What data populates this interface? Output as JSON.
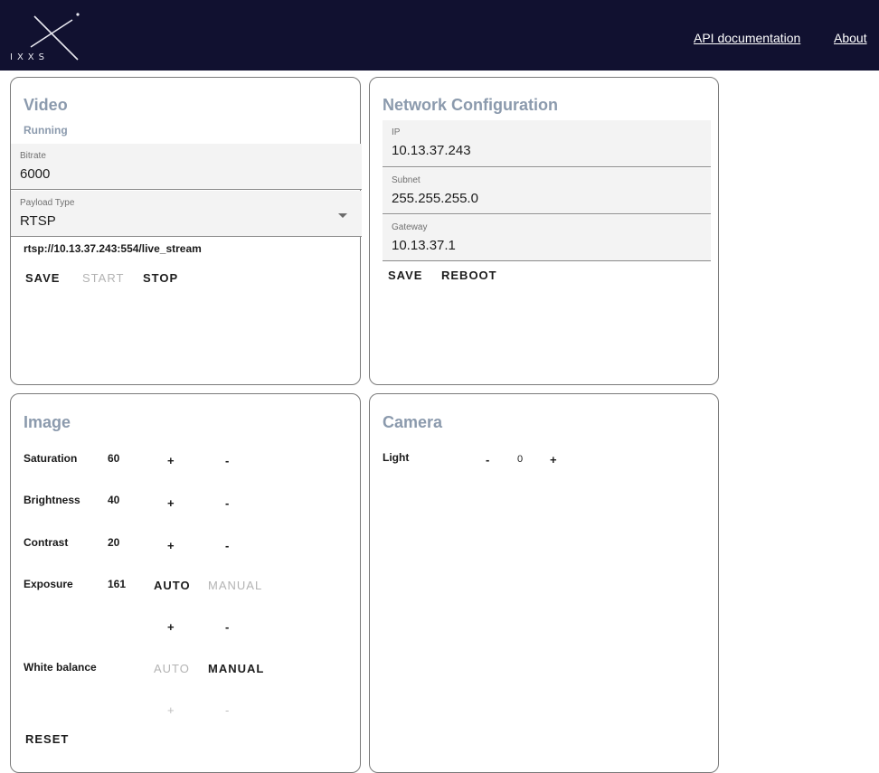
{
  "header": {
    "logo_text": "IXXS",
    "nav": {
      "api_documentation": "API documentation",
      "about": "About"
    }
  },
  "video": {
    "title": "Video",
    "status": "Running",
    "bitrate": {
      "label": "Bitrate",
      "value": "6000"
    },
    "payload_type": {
      "label": "Payload Type",
      "value": "RTSP"
    },
    "stream_url": "rtsp://10.13.37.243:554/live_stream",
    "buttons": {
      "save": "SAVE",
      "start": "START",
      "stop": "STOP"
    }
  },
  "network": {
    "title": "Network Configuration",
    "ip": {
      "label": "IP",
      "value": "10.13.37.243"
    },
    "subnet": {
      "label": "Subnet",
      "value": "255.255.255.0"
    },
    "gateway": {
      "label": "Gateway",
      "value": "10.13.37.1"
    },
    "buttons": {
      "save": "SAVE",
      "reboot": "REBOOT"
    }
  },
  "image": {
    "title": "Image",
    "saturation": {
      "label": "Saturation",
      "value": "60",
      "plus": "+",
      "minus": "-"
    },
    "brightness": {
      "label": "Brightness",
      "value": "40",
      "plus": "+",
      "minus": "-"
    },
    "contrast": {
      "label": "Contrast",
      "value": "20",
      "plus": "+",
      "minus": "-"
    },
    "exposure": {
      "label": "Exposure",
      "value": "161",
      "auto": "AUTO",
      "manual": "MANUAL",
      "plus": "+",
      "minus": "-"
    },
    "white_balance": {
      "label": "White balance",
      "auto": "AUTO",
      "manual": "MANUAL",
      "plus": "+",
      "minus": "-"
    },
    "reset": "RESET"
  },
  "camera": {
    "title": "Camera",
    "light": {
      "label": "Light",
      "minus": "-",
      "value": "0",
      "plus": "+"
    }
  }
}
